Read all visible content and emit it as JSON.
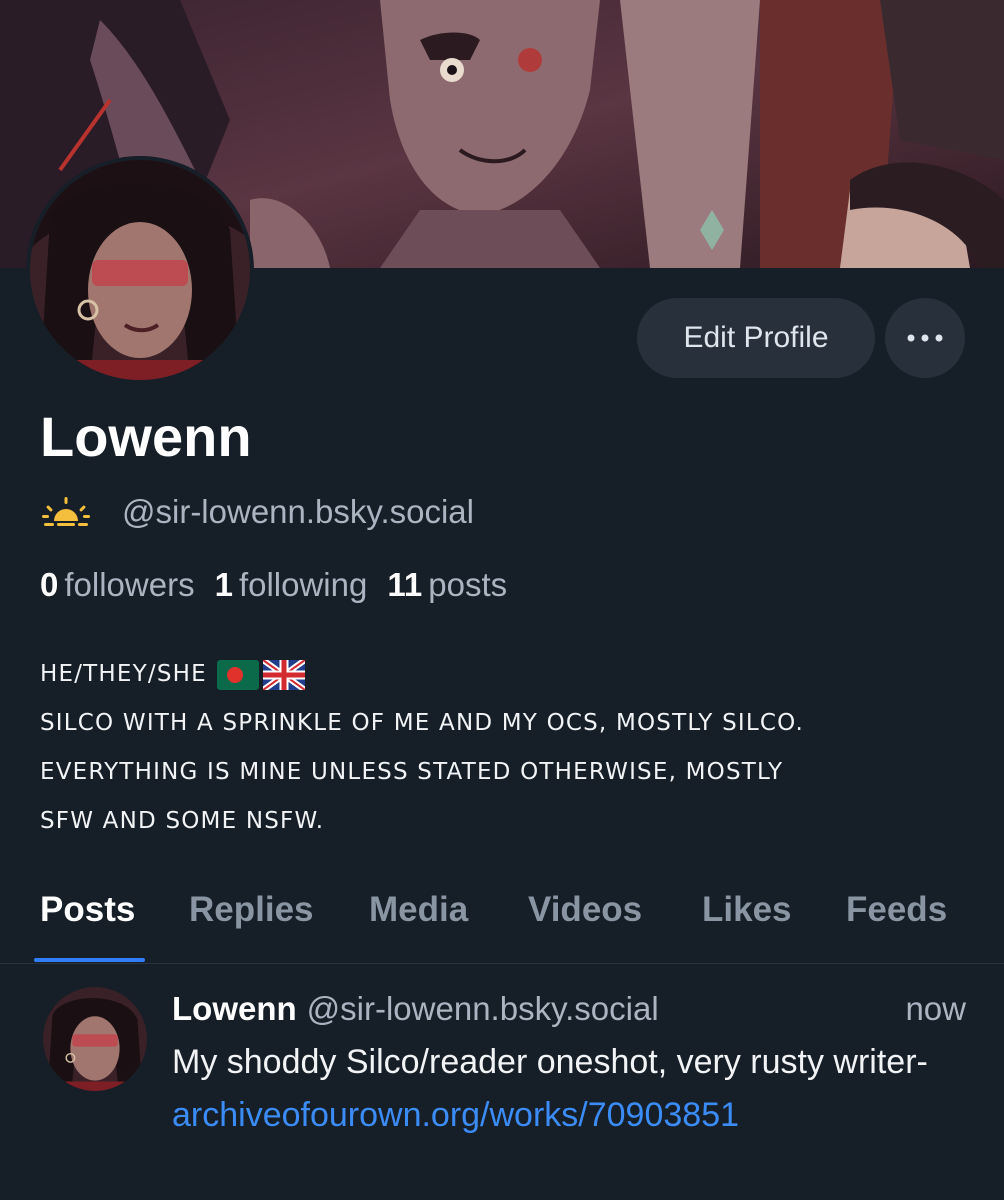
{
  "profile": {
    "display_name": "Lowenn",
    "handle": "@sir-lowenn.bsky.social",
    "handle_badge_icon": "sunrise-icon"
  },
  "actions": {
    "edit_profile_label": "Edit Profile",
    "more_icon": "ellipsis-icon"
  },
  "stats": {
    "followers_count": "0",
    "followers_label": "followers",
    "following_count": "1",
    "following_label": "following",
    "posts_count": "11",
    "posts_label": "posts"
  },
  "bio": {
    "line1": "HE/THEY/SHE",
    "flags": [
      "bangladesh-flag-icon",
      "uk-flag-icon"
    ],
    "line2": "SILCO WITH A SPRINKLE OF ME AND MY OCS, MOSTLY SILCO.",
    "line3": "EVERYTHING IS MINE UNLESS STATED OTHERWISE, MOSTLY",
    "line4": "SFW AND SOME NSFW."
  },
  "tabs": [
    {
      "label": "Posts",
      "active": true
    },
    {
      "label": "Replies",
      "active": false
    },
    {
      "label": "Media",
      "active": false
    },
    {
      "label": "Videos",
      "active": false
    },
    {
      "label": "Likes",
      "active": false
    },
    {
      "label": "Feeds",
      "active": false
    }
  ],
  "post": {
    "author": "Lowenn",
    "handle": "@sir-lowenn.bsky.social",
    "time": "now",
    "text": "My shoddy Silco/reader oneshot, very rusty writer-",
    "link": "archiveofourown.org/works/70903851"
  },
  "colors": {
    "background": "#161e27",
    "accent": "#2f7ef7",
    "link": "#3b8cf6",
    "button_bg": "#28303b",
    "muted_text": "#aab5c1"
  }
}
